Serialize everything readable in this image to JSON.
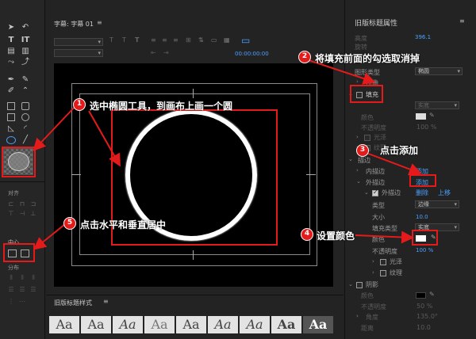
{
  "title_panel": {
    "label": "字幕: 字幕 01",
    "timecode": "00:00:00:00"
  },
  "properties_panel": {
    "title": "旧版标题属性",
    "rows": {
      "height_label": "高度",
      "height_value": "396.1",
      "rotation_label": "旋转",
      "shape_type_label": "图形类型",
      "shape_type_value": "椭圆",
      "distort_label": "扭曲",
      "fill_label": "填充",
      "fill_type_value": "实底",
      "color_label": "颜色",
      "opacity_label": "不透明度",
      "opacity_value": "100 %",
      "gloss_label": "光泽",
      "texture_label": "纹理",
      "stroke_label": "描边",
      "inner_stroke_label": "内描边",
      "inner_add": "添加",
      "outer_stroke_label": "外描边",
      "outer_add": "添加",
      "outer_stroke_item": "外描边",
      "delete": "删除",
      "move_up": "上移",
      "type_label": "类型",
      "type_value": "边缘",
      "size_label": "大小",
      "size_value": "10.0",
      "fill_type_label": "填充类型",
      "fill_type_value2": "实底",
      "color_label2": "颜色",
      "opacity_label2": "不透明度",
      "opacity_value2": "100 %",
      "gloss_label2": "光泽",
      "texture_label2": "纹理",
      "shadow_label": "阴影",
      "shadow_color_label": "颜色",
      "shadow_opacity_label": "不透明度",
      "shadow_opacity_value": "50 %",
      "shadow_angle_label": "角度",
      "shadow_angle_value": "135.0°",
      "shadow_distance_label": "距离",
      "shadow_distance_value": "10.0"
    }
  },
  "tools_panel": {
    "align_label": "对齐",
    "center_label": "中心",
    "distribute_label": "分布"
  },
  "styles_panel": {
    "title": "旧版标题样式",
    "tiles": [
      "Aa",
      "Aa",
      "Aa",
      "Aa",
      "Aa",
      "Aa",
      "Aa",
      "Aa",
      "Aa"
    ]
  },
  "annotations": {
    "step1": {
      "num": "1",
      "text": "选中椭圆工具，到画布上画一个圆"
    },
    "step2": {
      "num": "2",
      "text": "将填充前面的勾选取消掉"
    },
    "step3": {
      "num": "3",
      "text": "点击添加"
    },
    "step4": {
      "num": "4",
      "text": "设置颜色"
    },
    "step5": {
      "num": "5",
      "text": "点击水平和垂直居中"
    }
  },
  "colors": {
    "annotation_red": "#e51b1b",
    "link_blue": "#4aa0ff",
    "canvas": "#000000"
  }
}
